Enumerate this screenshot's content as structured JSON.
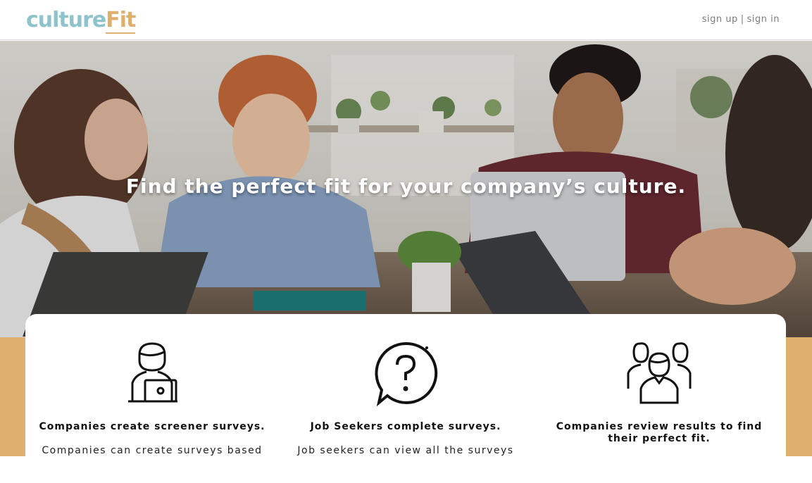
{
  "header": {
    "logo_part1": "culture",
    "logo_part2": "Fit",
    "sign_up": "sign up",
    "separator": "|",
    "sign_in": "sign in"
  },
  "hero": {
    "title": "Find the perfect fit for your company’s culture."
  },
  "features": [
    {
      "icon": "person-laptop-icon",
      "heading": "Companies create screener surveys.",
      "text": "Companies can create surveys based"
    },
    {
      "icon": "question-bubble-icon",
      "heading": "Job Seekers complete surveys.",
      "text": "Job seekers can view all the surveys"
    },
    {
      "icon": "team-icon",
      "heading": "Companies review results to find their perfect fit.",
      "text": ""
    }
  ],
  "colors": {
    "logo_teal": "#8fc3cc",
    "logo_tan": "#ddb06f",
    "band_tan": "#ddb06f"
  }
}
